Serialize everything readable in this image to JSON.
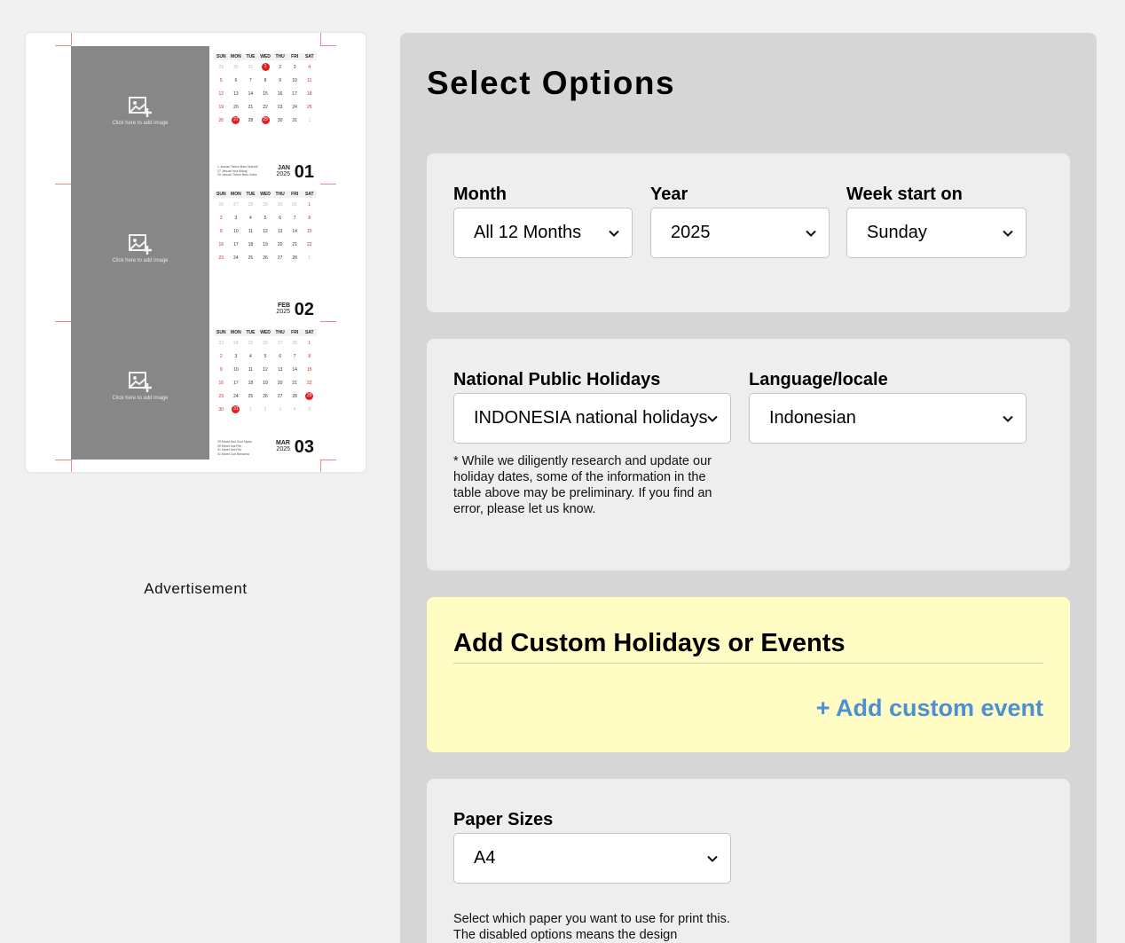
{
  "preview": {
    "photo_hint": "Click here to add image",
    "weekdays": [
      "SUN",
      "MON",
      "TUE",
      "WED",
      "THU",
      "FRI",
      "SAT"
    ],
    "months": [
      {
        "name": "JAN",
        "year": "2025",
        "num": "01",
        "weeks": [
          [
            [
              "29",
              "g"
            ],
            [
              "30",
              "g"
            ],
            [
              "31",
              "g"
            ],
            [
              "1",
              "hol"
            ],
            [
              "2",
              ""
            ],
            [
              "3",
              ""
            ],
            [
              "4",
              "r"
            ]
          ],
          [
            [
              "5",
              "r"
            ],
            [
              "6",
              ""
            ],
            [
              "7",
              ""
            ],
            [
              "8",
              ""
            ],
            [
              "9",
              ""
            ],
            [
              "10",
              ""
            ],
            [
              "11",
              "r"
            ]
          ],
          [
            [
              "12",
              "r"
            ],
            [
              "13",
              ""
            ],
            [
              "14",
              ""
            ],
            [
              "15",
              ""
            ],
            [
              "16",
              ""
            ],
            [
              "17",
              ""
            ],
            [
              "18",
              "r"
            ]
          ],
          [
            [
              "19",
              "r"
            ],
            [
              "20",
              ""
            ],
            [
              "21",
              ""
            ],
            [
              "22",
              ""
            ],
            [
              "23",
              ""
            ],
            [
              "24",
              ""
            ],
            [
              "25",
              "r"
            ]
          ],
          [
            [
              "26",
              "r"
            ],
            [
              "27",
              "hol"
            ],
            [
              "28",
              ""
            ],
            [
              "29",
              "hol"
            ],
            [
              "30",
              ""
            ],
            [
              "31",
              ""
            ],
            [
              "1",
              "g"
            ]
          ]
        ],
        "notes": [
          "1 Januari Tahun Baru Masehi",
          "27 Januari Isra Mikraj",
          "29 Januari Tahun Baru Imlek"
        ]
      },
      {
        "name": "FEB",
        "year": "2025",
        "num": "02",
        "weeks": [
          [
            [
              "26",
              "g"
            ],
            [
              "27",
              "g"
            ],
            [
              "28",
              "g"
            ],
            [
              "29",
              "g"
            ],
            [
              "30",
              "g"
            ],
            [
              "31",
              "g"
            ],
            [
              "1",
              "r"
            ]
          ],
          [
            [
              "2",
              "r"
            ],
            [
              "3",
              ""
            ],
            [
              "4",
              ""
            ],
            [
              "5",
              ""
            ],
            [
              "6",
              ""
            ],
            [
              "7",
              ""
            ],
            [
              "8",
              "r"
            ]
          ],
          [
            [
              "9",
              "r"
            ],
            [
              "10",
              ""
            ],
            [
              "11",
              ""
            ],
            [
              "12",
              ""
            ],
            [
              "13",
              ""
            ],
            [
              "14",
              ""
            ],
            [
              "15",
              "r"
            ]
          ],
          [
            [
              "16",
              "r"
            ],
            [
              "17",
              ""
            ],
            [
              "18",
              ""
            ],
            [
              "19",
              ""
            ],
            [
              "20",
              ""
            ],
            [
              "21",
              ""
            ],
            [
              "22",
              "r"
            ]
          ],
          [
            [
              "23",
              "r"
            ],
            [
              "24",
              ""
            ],
            [
              "25",
              ""
            ],
            [
              "26",
              ""
            ],
            [
              "27",
              ""
            ],
            [
              "28",
              ""
            ],
            [
              "1",
              "g"
            ]
          ]
        ],
        "notes": []
      },
      {
        "name": "MAR",
        "year": "2025",
        "num": "03",
        "weeks": [
          [
            [
              "23",
              "g"
            ],
            [
              "24",
              "g"
            ],
            [
              "25",
              "g"
            ],
            [
              "26",
              "g"
            ],
            [
              "27",
              "g"
            ],
            [
              "28",
              "g"
            ],
            [
              "1",
              "r"
            ]
          ],
          [
            [
              "2",
              "r"
            ],
            [
              "3",
              ""
            ],
            [
              "4",
              ""
            ],
            [
              "5",
              ""
            ],
            [
              "6",
              ""
            ],
            [
              "7",
              ""
            ],
            [
              "8",
              "r"
            ]
          ],
          [
            [
              "9",
              "r"
            ],
            [
              "10",
              ""
            ],
            [
              "11",
              ""
            ],
            [
              "12",
              ""
            ],
            [
              "13",
              ""
            ],
            [
              "14",
              ""
            ],
            [
              "15",
              "r"
            ]
          ],
          [
            [
              "16",
              "r"
            ],
            [
              "17",
              ""
            ],
            [
              "18",
              ""
            ],
            [
              "19",
              ""
            ],
            [
              "20",
              ""
            ],
            [
              "21",
              ""
            ],
            [
              "22",
              "r"
            ]
          ],
          [
            [
              "23",
              "r"
            ],
            [
              "24",
              ""
            ],
            [
              "25",
              ""
            ],
            [
              "26",
              ""
            ],
            [
              "27",
              ""
            ],
            [
              "28",
              ""
            ],
            [
              "29",
              "hol"
            ]
          ],
          [
            [
              "30",
              "r"
            ],
            [
              "31",
              "hol"
            ],
            [
              "1",
              "g"
            ],
            [
              "2",
              "g"
            ],
            [
              "3",
              "g"
            ],
            [
              "4",
              "g"
            ],
            [
              "5",
              "g"
            ]
          ]
        ],
        "notes": [
          "29 Maret Hari Suci Nyepi",
          "30 Maret Idul Fitri",
          "31 Maret Idul Fitri",
          "31 Maret Cuti Bersama"
        ]
      }
    ]
  },
  "advertisement_label": "Advertisement",
  "options": {
    "title": "Select Options",
    "month": {
      "label": "Month",
      "value": "All 12 Months"
    },
    "year": {
      "label": "Year",
      "value": "2025"
    },
    "week_start": {
      "label": "Week start on",
      "value": "Sunday"
    },
    "holidays": {
      "label": "National Public Holidays",
      "value": "INDONESIA national holidays"
    },
    "locale": {
      "label": "Language/locale",
      "value": "Indonesian"
    },
    "holiday_note": "* While we diligently research and update our holiday dates, some of the information in the table above may be preliminary. If you find an error, please let us know.",
    "custom": {
      "title": "Add Custom Holidays or Events",
      "add_label": "+ Add custom event"
    },
    "paper": {
      "label": "Paper Sizes",
      "value": "A4",
      "note": "Select which paper you want to use for print this. The disabled options means the design"
    }
  },
  "colors": {
    "accent": "#4a90d2",
    "holiday_red": "#e02020",
    "panel_bg": "#d6d6d6",
    "card_bg": "#eeeeee",
    "custom_bg": "#fffcc4"
  },
  "icons": {
    "photo": "add-image-icon",
    "dropdown": "chevron-down-icon"
  }
}
